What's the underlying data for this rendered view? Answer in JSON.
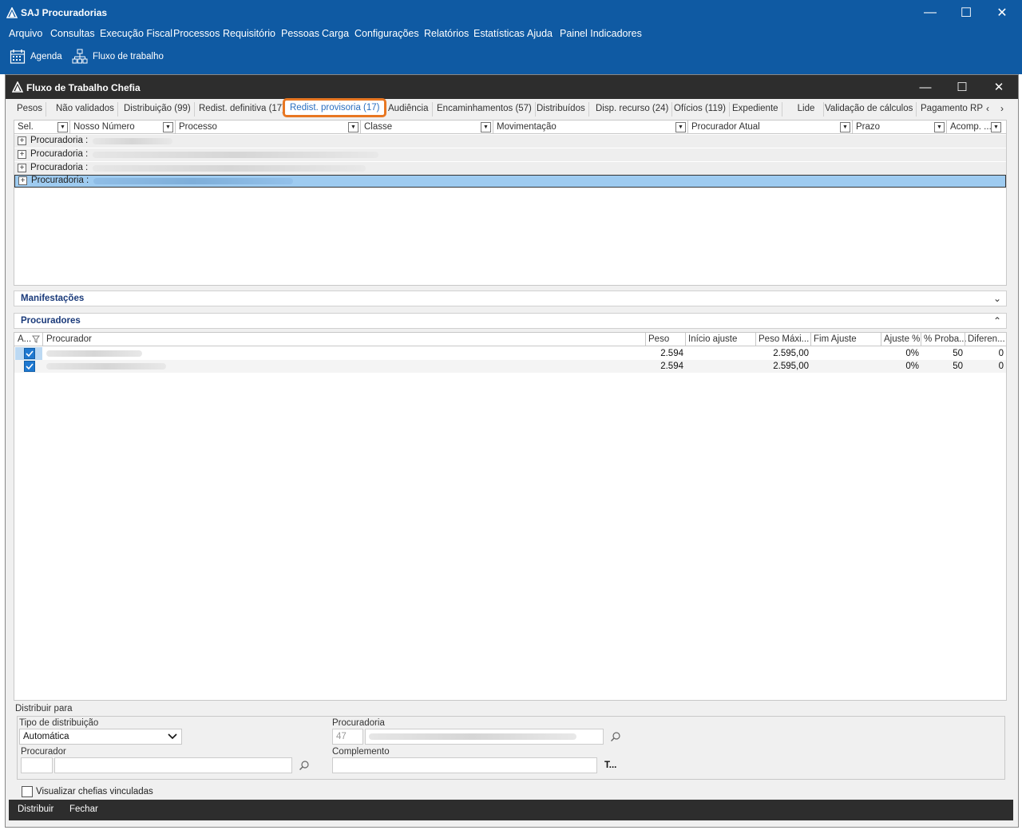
{
  "app": {
    "title": "SAJ Procuradorias",
    "window_controls": {
      "minimize": "—",
      "maximize": "☐",
      "close": "✕"
    }
  },
  "menu": [
    "Arquivo",
    "Consultas",
    "Execução Fiscal",
    "Processos",
    "Requisitório",
    "Pessoas",
    "Carga",
    "Configurações",
    "Relatórios",
    "Estatísticas",
    "Ajuda",
    "Painel Indicadores"
  ],
  "toolbar": {
    "agenda_label": "Agenda",
    "fluxo_label": "Fluxo de trabalho"
  },
  "inner_window": {
    "title": "Fluxo de Trabalho Chefia"
  },
  "tabs": [
    {
      "label": "Pesos"
    },
    {
      "label": "Não validados"
    },
    {
      "label": "Distribuição (99)"
    },
    {
      "label": "Redist. definitiva (17)"
    },
    {
      "label": "Redist. provisoria (17)",
      "active": true
    },
    {
      "label": "Audiência"
    },
    {
      "label": "Encaminhamentos (57)"
    },
    {
      "label": "Distribuídos"
    },
    {
      "label": "Disp. recurso (24)"
    },
    {
      "label": "Ofícios (119)"
    },
    {
      "label": "Expediente"
    },
    {
      "label": "Lide"
    },
    {
      "label": "Validação de cálculos"
    },
    {
      "label": "Pagamento RP\\"
    }
  ],
  "tab_scroll": {
    "left": "‹",
    "right": "›"
  },
  "grid": {
    "columns": [
      "Sel.",
      "Nosso Número",
      "Processo",
      "Classe",
      "Movimentação",
      "Procurador Atual",
      "Prazo",
      "Acomp. ..."
    ],
    "groups": [
      {
        "label": "Procuradoria :",
        "expander": "+"
      },
      {
        "label": "Procuradoria :",
        "expander": "+"
      },
      {
        "label": "Procuradoria :",
        "expander": "+"
      },
      {
        "label": "Procuradoria :",
        "expander": "+",
        "selected": true
      }
    ]
  },
  "sections": {
    "manifestacoes": {
      "title": "Manifestações",
      "chevron": "⌄"
    },
    "procuradores": {
      "title": "Procuradores",
      "chevron": "⌃"
    }
  },
  "procuradores_grid": {
    "columns": [
      "A...",
      "Procurador",
      "Peso",
      "Início ajuste",
      "Peso Máxi...",
      "Fim Ajuste",
      "Ajuste %",
      "% Proba...",
      "Diferen..."
    ],
    "rows": [
      {
        "checked": true,
        "peso": "2.594",
        "peso_max": "2.595,00",
        "ajuste": "0%",
        "proba": "50",
        "diferenca": "0"
      },
      {
        "checked": true,
        "peso": "2.594",
        "peso_max": "2.595,00",
        "ajuste": "0%",
        "proba": "50",
        "diferenca": "0"
      }
    ]
  },
  "distribuir_para": {
    "legend": "Distribuir para",
    "tipo_label": "Tipo de distribuição",
    "tipo_value": "Automática",
    "procuradoria_label": "Procuradoria",
    "procuradoria_code": "47",
    "procurador_label": "Procurador",
    "complemento_label": "Complemento",
    "complemento_button": "T..."
  },
  "visualizar_chefias": {
    "label": "Visualizar chefias vinculadas",
    "checked": false
  },
  "bottom_buttons": {
    "distribuir": "Distribuir",
    "fechar": "Fechar"
  },
  "colors": {
    "titlebar": "#0f5aa3",
    "inner_titlebar": "#2d2d2d",
    "active_tab_outline": "#e87722",
    "selected_row": "#9ecbf0"
  }
}
